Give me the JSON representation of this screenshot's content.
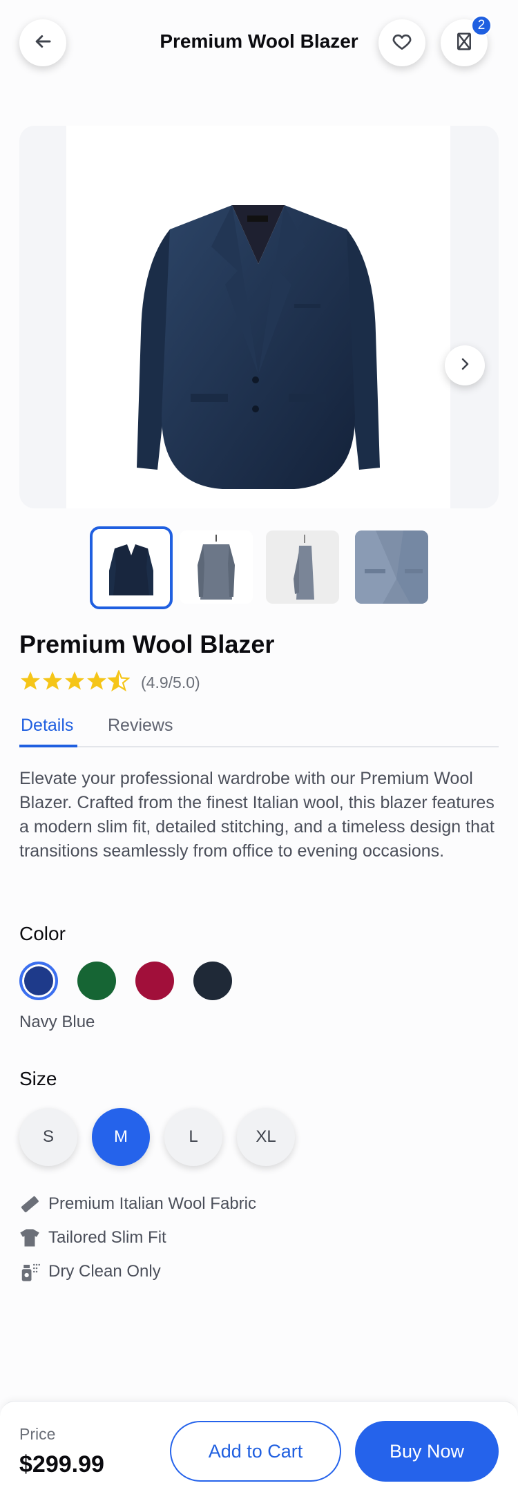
{
  "header": {
    "title": "Premium Wool Blazer",
    "back_icon": "arrow-left-icon",
    "wishlist_icon": "heart-icon",
    "compare_icon": "hourglass-icon",
    "badge_count": "2"
  },
  "gallery": {
    "next_icon": "chevron-right-icon",
    "thumbnails": [
      "thumbnail-front",
      "thumbnail-back",
      "thumbnail-side",
      "thumbnail-detail"
    ]
  },
  "product": {
    "title": "Premium Wool Blazer",
    "rating": 4.9,
    "rating_text": "(4.9/5.0)",
    "description": "Elevate your professional wardrobe with our Premium Wool Blazer. Crafted from the finest Italian wool, this blazer features a modern slim fit, detailed stitching, and a timeless design that transitions seamlessly from office to evening occasions."
  },
  "tabs": [
    {
      "label": "Details",
      "active": true
    },
    {
      "label": "Reviews",
      "active": false
    }
  ],
  "color": {
    "label": "Color",
    "swatches": [
      "#1e3a8a",
      "#166534",
      "#a10f3a",
      "#1f2937"
    ],
    "selected_name": "Navy Blue"
  },
  "size": {
    "label": "Size",
    "options": [
      "S",
      "M",
      "L",
      "XL"
    ],
    "selected": "M"
  },
  "features": [
    {
      "icon": "ruler-icon",
      "label": "Premium Italian Wool Fabric"
    },
    {
      "icon": "tshirt-icon",
      "label": "Tailored Slim Fit"
    },
    {
      "icon": "spray-bottle-icon",
      "label": "Dry Clean Only"
    }
  ],
  "footer": {
    "price_label": "Price",
    "price_value": "$299.99",
    "add_to_cart": "Add to Cart",
    "buy_now": "Buy Now"
  },
  "colors": {
    "accent": "#2563eb",
    "star": "#f5c518"
  }
}
